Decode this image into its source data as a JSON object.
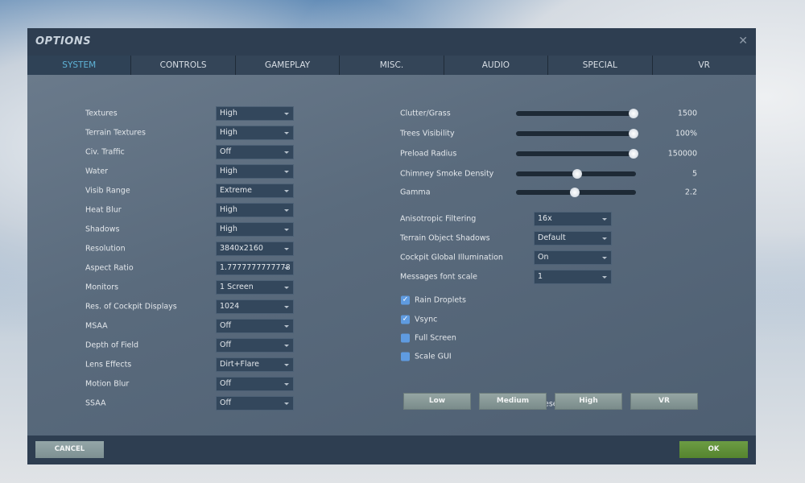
{
  "window": {
    "title": "OPTIONS",
    "close_icon": "close-icon"
  },
  "tabs": [
    "SYSTEM",
    "CONTROLS",
    "GAMEPLAY",
    "MISC.",
    "AUDIO",
    "SPECIAL",
    "VR"
  ],
  "active_tab": "SYSTEM",
  "left_settings": [
    {
      "label": "Textures",
      "value": "High"
    },
    {
      "label": "Terrain Textures",
      "value": "High"
    },
    {
      "label": "Civ. Traffic",
      "value": "Off"
    },
    {
      "label": "Water",
      "value": "High"
    },
    {
      "label": "Visib Range",
      "value": "Extreme"
    },
    {
      "label": "Heat Blur",
      "value": "High"
    },
    {
      "label": "Shadows",
      "value": "High"
    },
    {
      "label": "Resolution",
      "value": "3840x2160"
    },
    {
      "label": "Aspect Ratio",
      "value": "1.7777777777778"
    },
    {
      "label": "Monitors",
      "value": "1 Screen"
    },
    {
      "label": "Res. of Cockpit Displays",
      "value": "1024"
    },
    {
      "label": "MSAA",
      "value": "Off"
    },
    {
      "label": "Depth of Field",
      "value": "Off"
    },
    {
      "label": "Lens Effects",
      "value": "Dirt+Flare"
    },
    {
      "label": "Motion Blur",
      "value": "Off"
    },
    {
      "label": "SSAA",
      "value": "Off"
    }
  ],
  "sliders": [
    {
      "label": "Clutter/Grass",
      "value": "1500",
      "level": 1.0
    },
    {
      "label": "Trees Visibility",
      "value": "100%",
      "level": 1.0
    },
    {
      "label": "Preload Radius",
      "value": "150000",
      "level": 1.0
    },
    {
      "label": "Chimney Smoke Density",
      "value": "5",
      "level": 0.5
    },
    {
      "label": "Gamma",
      "value": "2.2",
      "level": 0.48
    }
  ],
  "right_settings": [
    {
      "label": "Anisotropic Filtering",
      "value": "16x"
    },
    {
      "label": "Terrain Object Shadows",
      "value": "Default"
    },
    {
      "label": "Cockpit Global Illumination",
      "value": "On"
    },
    {
      "label": "Messages font scale",
      "value": "1"
    }
  ],
  "checkboxes": [
    {
      "label": "Rain Droplets",
      "checked": true
    },
    {
      "label": "Vsync",
      "checked": true
    },
    {
      "label": "Full Screen",
      "checked": false
    },
    {
      "label": "Scale GUI",
      "checked": false
    }
  ],
  "presets": {
    "label": "Presets",
    "buttons": [
      "Low",
      "Medium",
      "High",
      "VR"
    ]
  },
  "footer": {
    "cancel": "CANCEL",
    "ok": "OK"
  },
  "colors": {
    "active_tab": "#5fb4d8",
    "ok": "#5f8f3a",
    "checkbox": "#5f9be0"
  }
}
